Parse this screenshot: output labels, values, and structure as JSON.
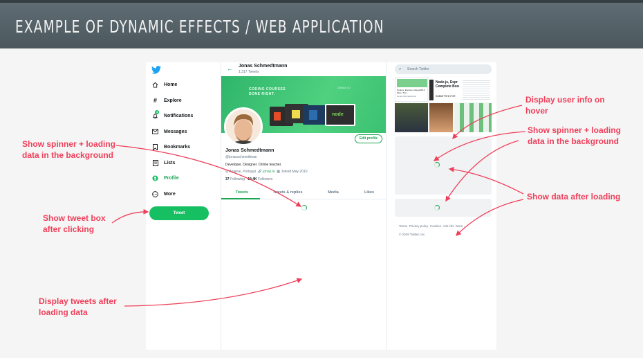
{
  "slide_title": "EXAMPLE OF DYNAMIC EFFECTS / WEB APPLICATION",
  "nav": {
    "items": [
      {
        "label": "Home",
        "icon": "home-icon"
      },
      {
        "label": "Explore",
        "icon": "hashtag-icon"
      },
      {
        "label": "Notifications",
        "icon": "bell-icon",
        "badge": "4"
      },
      {
        "label": "Messages",
        "icon": "envelope-icon"
      },
      {
        "label": "Bookmarks",
        "icon": "bookmark-icon"
      },
      {
        "label": "Lists",
        "icon": "list-icon"
      },
      {
        "label": "Profile",
        "icon": "profile-icon",
        "active": true
      },
      {
        "label": "More",
        "icon": "more-icon"
      }
    ],
    "tweet_button": "Tweet"
  },
  "profile": {
    "header_name": "Jonas Schmedtmann",
    "header_tweets": "1,317 Tweets",
    "cover_text": "CODING COURSES DONE RIGHT.",
    "cover_brand": "JONAS.IO",
    "cover_thumb_label": "node",
    "edit_button": "Edit profile",
    "name": "Jonas Schmedtmann",
    "handle": "@jonasschmedtman",
    "bio": "Developer. Designer. Online teacher.",
    "location": "Algarve, Portugal",
    "website": "jonas.io",
    "joined": "Joined May 2010",
    "following_count": "37",
    "following_label": "Following",
    "followers_count": "19.4K",
    "followers_label": "Followers",
    "tabs": [
      "Tweets",
      "Tweets & replies",
      "Media",
      "Likes"
    ]
  },
  "right": {
    "search_placeholder": "Search Twitter",
    "preview_title": "Node.js, Expr Complete Boo",
    "preview_sub": "SUBMITTED FOR",
    "preview_small": "Node.js, Express, MongoDB & More: The...",
    "preview_small_author": "Jonas Schmedtmann",
    "footer_links": [
      "Terms",
      "Privacy policy",
      "Cookies",
      "Ads info",
      "More"
    ],
    "footer_copy": "© 2019 Twitter, Inc."
  },
  "annotations": {
    "spinner_left": "Show spinner + loading data in the background",
    "tweet_box": "Show tweet box after clicking",
    "display_tweets": "Display tweets after loading data",
    "user_info": "Display user info on hover",
    "spinner_right": "Show spinner + loading data in the background",
    "data_after": "Show data after loading"
  },
  "colors": {
    "accent": "#17bf63",
    "annotation": "#ef3f5a",
    "banner": "#56636a"
  }
}
